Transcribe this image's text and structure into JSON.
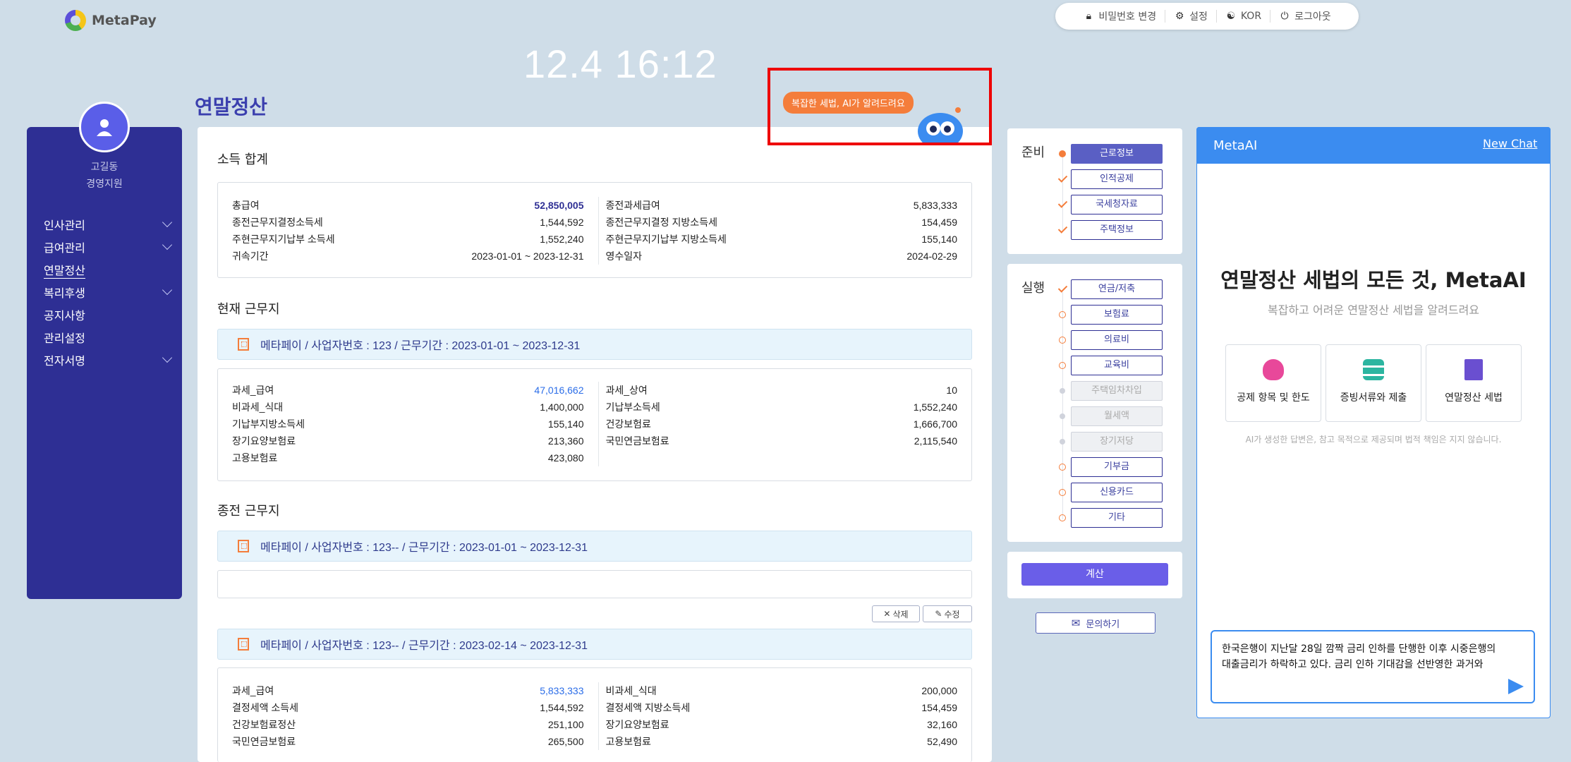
{
  "app": {
    "name": "MetaPay"
  },
  "topbar": {
    "password": "비밀번호 변경",
    "settings": "설정",
    "lang": "KOR",
    "logout": "로그아웃"
  },
  "clock": "12.4 16:12",
  "page_title": "연말정산",
  "ai_hint": "복잡한 세법, AI가 알려드려요",
  "user": {
    "name": "고길동",
    "dept": "경영지원"
  },
  "sidebar": [
    {
      "label": "인사관리",
      "expand": true
    },
    {
      "label": "급여관리",
      "expand": true
    },
    {
      "label": "연말정산",
      "expand": false,
      "active": true
    },
    {
      "label": "복리후생",
      "expand": true
    },
    {
      "label": "공지사항",
      "expand": false
    },
    {
      "label": "관리설정",
      "expand": false
    },
    {
      "label": "전자서명",
      "expand": true
    }
  ],
  "income": {
    "title": "소득 합계",
    "left": [
      [
        "총급여",
        "52,850,005"
      ],
      [
        "종전근무지결정소득세",
        "1,544,592"
      ],
      [
        "주현근무지기납부 소득세",
        "1,552,240"
      ],
      [
        "귀속기간",
        "2023-01-01 ~ 2023-12-31"
      ]
    ],
    "right": [
      [
        "종전과세급여",
        "5,833,333"
      ],
      [
        "종전근무지결정 지방소득세",
        "154,459"
      ],
      [
        "주현근무지기납부 지방소득세",
        "155,140"
      ],
      [
        "영수일자",
        "2024-02-29"
      ]
    ]
  },
  "current": {
    "title": "현재 근무지",
    "company": "메타페이 / 사업자번호 : 123 / 근무기간 : 2023-01-01 ~ 2023-12-31",
    "left": [
      [
        "과세_급여",
        "47,016,662"
      ],
      [
        "비과세_식대",
        "1,400,000"
      ],
      [
        "기납부지방소득세",
        "155,140"
      ],
      [
        "장기요양보험료",
        "213,360"
      ],
      [
        "고용보험료",
        "423,080"
      ]
    ],
    "right": [
      [
        "과세_상여",
        "10"
      ],
      [
        "기납부소득세",
        "1,552,240"
      ],
      [
        "건강보험료",
        "1,666,700"
      ],
      [
        "국민연금보험료",
        "2,115,540"
      ]
    ]
  },
  "previous": {
    "title": "종전 근무지",
    "company1": "메타페이 / 사업자번호 : 123-- / 근무기간 : 2023-01-01 ~ 2023-12-31",
    "delete": "삭제",
    "edit": "수정",
    "company2": "메타페이 / 사업자번호 : 123-- / 근무기간 : 2023-02-14 ~ 2023-12-31",
    "left": [
      [
        "과세_급여",
        "5,833,333"
      ],
      [
        "결정세액 소득세",
        "1,544,592"
      ],
      [
        "건강보험료정산",
        "251,100"
      ],
      [
        "국민연금보험료",
        "265,500"
      ]
    ],
    "right": [
      [
        "비과세_식대",
        "200,000"
      ],
      [
        "결정세액 지방소득세",
        "154,459"
      ],
      [
        "장기요양보험료",
        "32,160"
      ],
      [
        "고용보험료",
        "52,490"
      ]
    ]
  },
  "prepare": {
    "label": "준비",
    "steps": [
      {
        "label": "근로정보",
        "state": "selected",
        "mark": "dot"
      },
      {
        "label": "인적공제",
        "state": "normal",
        "mark": "check"
      },
      {
        "label": "국세청자료",
        "state": "normal",
        "mark": "check"
      },
      {
        "label": "주택정보",
        "state": "normal",
        "mark": "check"
      }
    ]
  },
  "execute": {
    "label": "실행",
    "steps": [
      {
        "label": "연금/저축",
        "state": "normal",
        "mark": "check"
      },
      {
        "label": "보험료",
        "state": "normal",
        "mark": "ring"
      },
      {
        "label": "의료비",
        "state": "normal",
        "mark": "ring"
      },
      {
        "label": "교육비",
        "state": "normal",
        "mark": "ring"
      },
      {
        "label": "주택임차차입",
        "state": "disabled",
        "mark": "grey"
      },
      {
        "label": "월세액",
        "state": "disabled",
        "mark": "grey"
      },
      {
        "label": "장기저당",
        "state": "disabled",
        "mark": "grey"
      },
      {
        "label": "기부금",
        "state": "normal",
        "mark": "ring"
      },
      {
        "label": "신용카드",
        "state": "normal",
        "mark": "ring"
      },
      {
        "label": "기타",
        "state": "normal",
        "mark": "ring"
      }
    ]
  },
  "calc": "계산",
  "ask": "문의하기",
  "metaai": {
    "title": "MetaAI",
    "new_chat": "New Chat",
    "hero": "연말정산 세법의 모든 것, MetaAI",
    "sub": "복잡하고 어려운 연말정산 세법을 알려드려요",
    "cards": [
      {
        "label": "공제 항목 및 한도",
        "icon": "money-bag-icon",
        "color": "#e8489a"
      },
      {
        "label": "증빙서류와 제출",
        "icon": "layers-icon",
        "color": "#2cb5a0"
      },
      {
        "label": "연말정산 세법",
        "icon": "book-icon",
        "color": "#6a4fd0"
      }
    ],
    "note": "AI가 생성한 답변은, 참고 목적으로 제공되며 법적 책임은 지지 않습니다.",
    "input_line1": "한국은행이 지난달 28일 깜짝 금리 인하를 단행한 이후 시중은행의",
    "input_line2": "대출금리가 하락하고 있다. 금리 인하 기대감을 선반영한 과거와"
  }
}
